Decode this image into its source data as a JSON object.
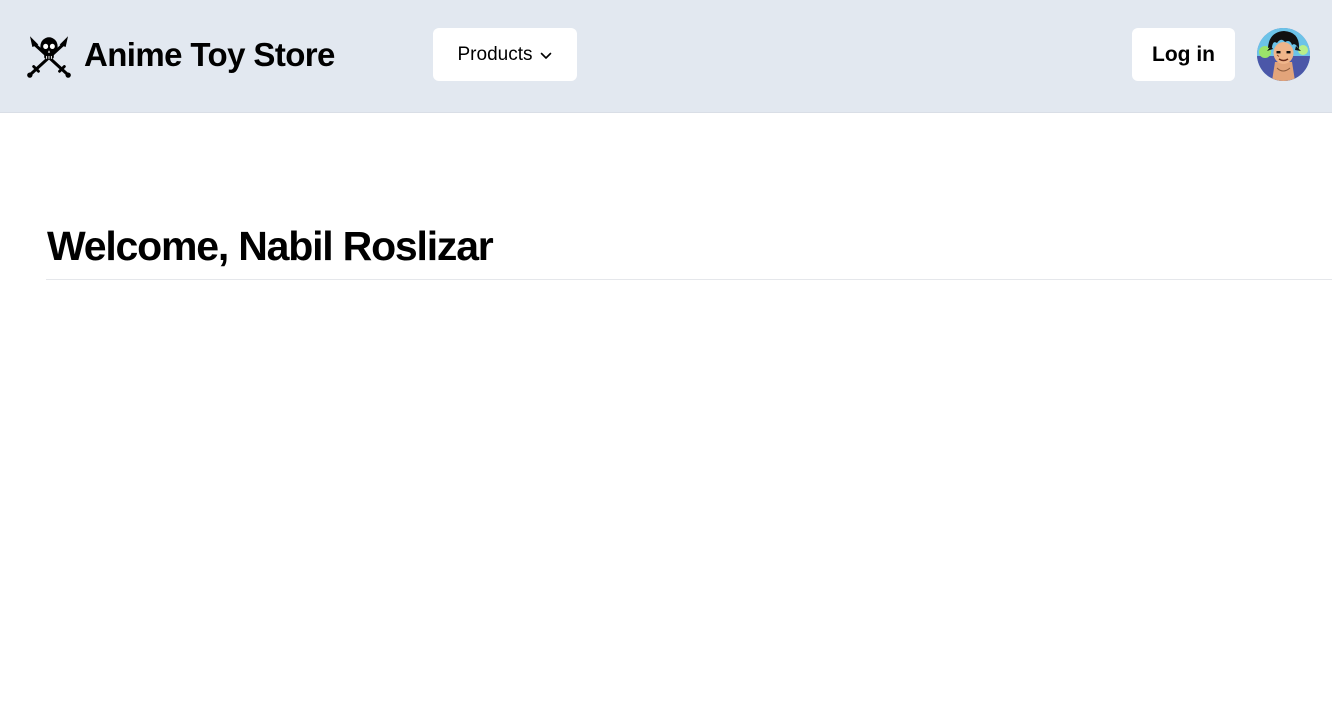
{
  "header": {
    "brand": {
      "name": "Anime Toy Store",
      "logo_icon": "jolly-roger-skull-crossed-swords-icon"
    },
    "nav": {
      "products_label": "Products",
      "products_icon": "chevron-down-icon"
    },
    "auth": {
      "login_label": "Log in"
    },
    "avatar": {
      "icon": "user-avatar-anime-character"
    }
  },
  "main": {
    "welcome_title": "Welcome, Nabil Roslizar"
  },
  "colors": {
    "header_background": "#e2e8f0",
    "button_background": "#ffffff",
    "text": "#000000",
    "page_background": "#ffffff",
    "divider": "#e5e7eb"
  }
}
